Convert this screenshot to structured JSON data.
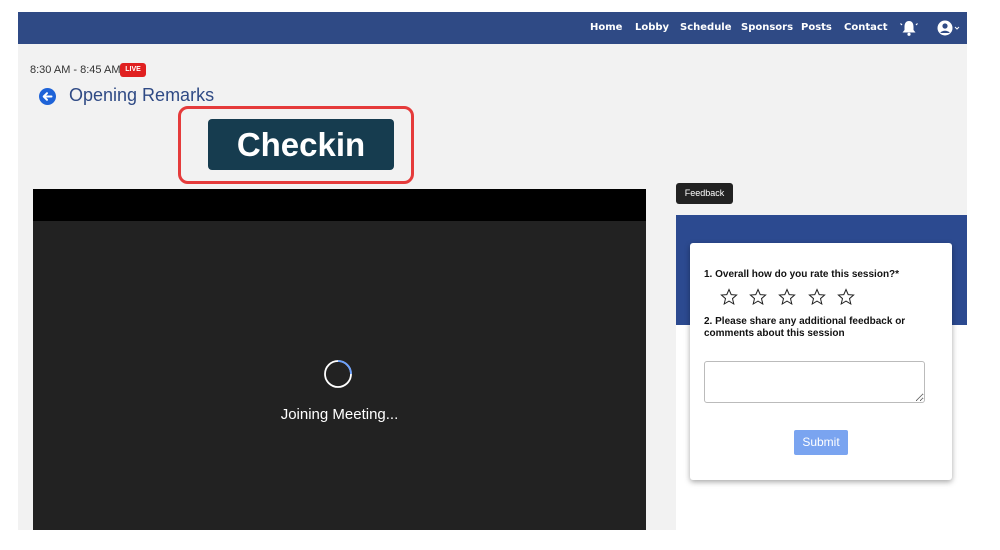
{
  "nav": {
    "items": [
      {
        "label": "Home"
      },
      {
        "label": "Lobby"
      },
      {
        "label": "Schedule"
      },
      {
        "label": "Sponsors"
      },
      {
        "label": "Posts"
      },
      {
        "label": "Contact"
      }
    ],
    "icons": [
      "bell-icon",
      "user-icon"
    ]
  },
  "session": {
    "time": "8:30 AM - 8:45 AM",
    "live_badge": "LIVE",
    "title": "Opening Remarks"
  },
  "checkin": {
    "label": "Checkin"
  },
  "video": {
    "status": "Joining Meeting..."
  },
  "feedback": {
    "tab_label": "Feedback",
    "q1": "1. Overall how do you rate this session?*",
    "rating": 0,
    "stars": 5,
    "q2": "2. Please share any additional feedback or comments about this session",
    "submit_label": "Submit"
  },
  "colors": {
    "nav_bg": "#2f4a85",
    "accent": "#2f4a85",
    "live": "#e02020",
    "checkin_bg": "#163c4f",
    "highlight": "#e53b3b",
    "submit": "#7aa4f0"
  }
}
